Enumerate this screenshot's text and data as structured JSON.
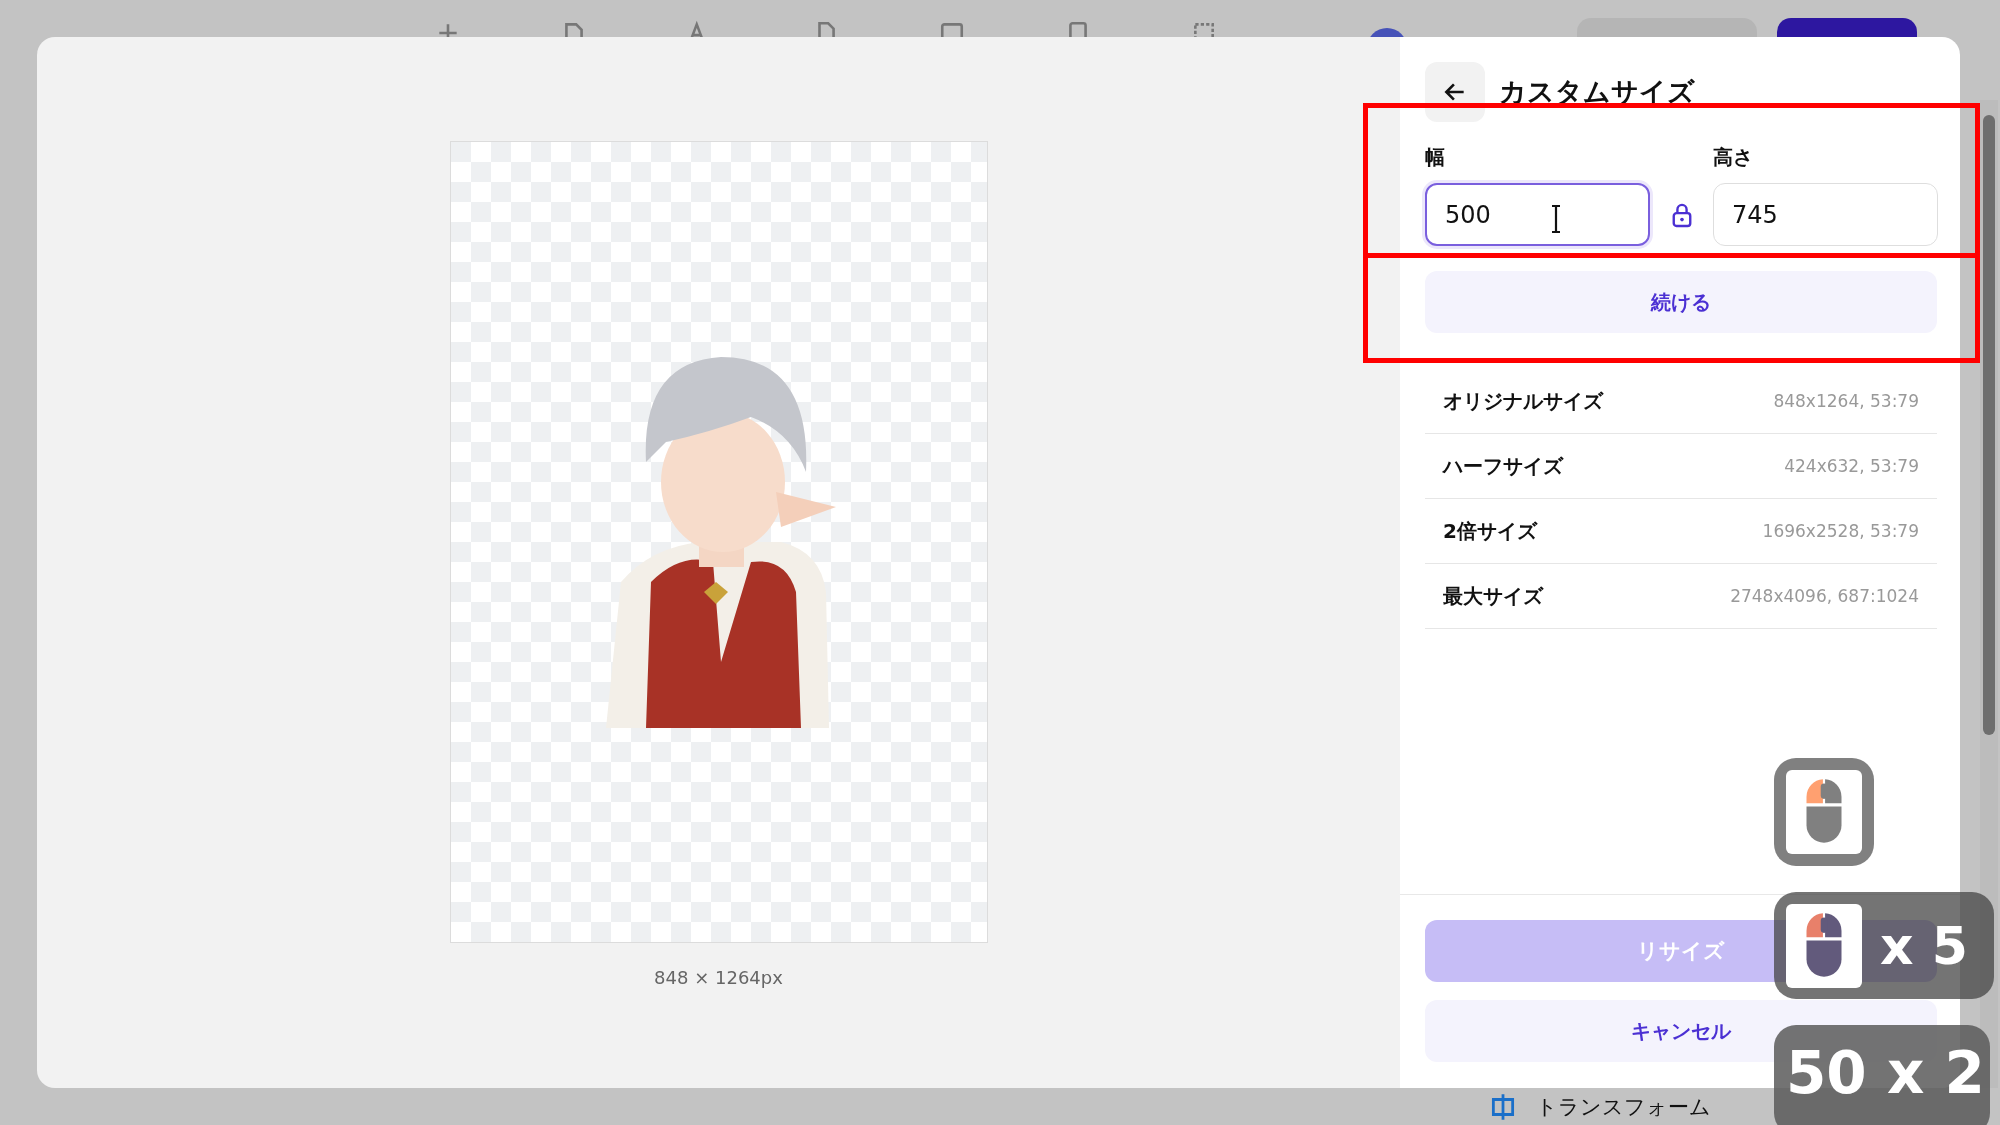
{
  "background_app": {
    "bottom_bar": {
      "label": "トランスフォーム"
    }
  },
  "dialog": {
    "canvas": {
      "kind": "picture",
      "size_label": "848 × 1264px"
    },
    "title": "カスタムサイズ",
    "width": {
      "label": "幅",
      "value": "500",
      "focused": true
    },
    "height": {
      "label": "高さ",
      "value": "745",
      "focused": false
    },
    "aspect_locked": true,
    "continue_button": "続ける",
    "presets": [
      {
        "label": "オリジナルサイズ",
        "value": "848x1264, 53:79"
      },
      {
        "label": "ハーフサイズ",
        "value": "424x632, 53:79"
      },
      {
        "label": "2倍サイズ",
        "value": "1696x2528, 53:79"
      },
      {
        "label": "最大サイズ",
        "value": "2748x4096, 687:1024"
      }
    ],
    "resize_button": {
      "label": "リサイズ",
      "disabled": true
    },
    "cancel_button": "キャンセル"
  },
  "key_overlays": [
    {
      "kind": "mouse",
      "color": "#ffa070"
    },
    {
      "kind": "mouse",
      "color": "#e8806a",
      "count": "x 5"
    },
    {
      "kind": "text",
      "count": "50 x 2"
    }
  ]
}
